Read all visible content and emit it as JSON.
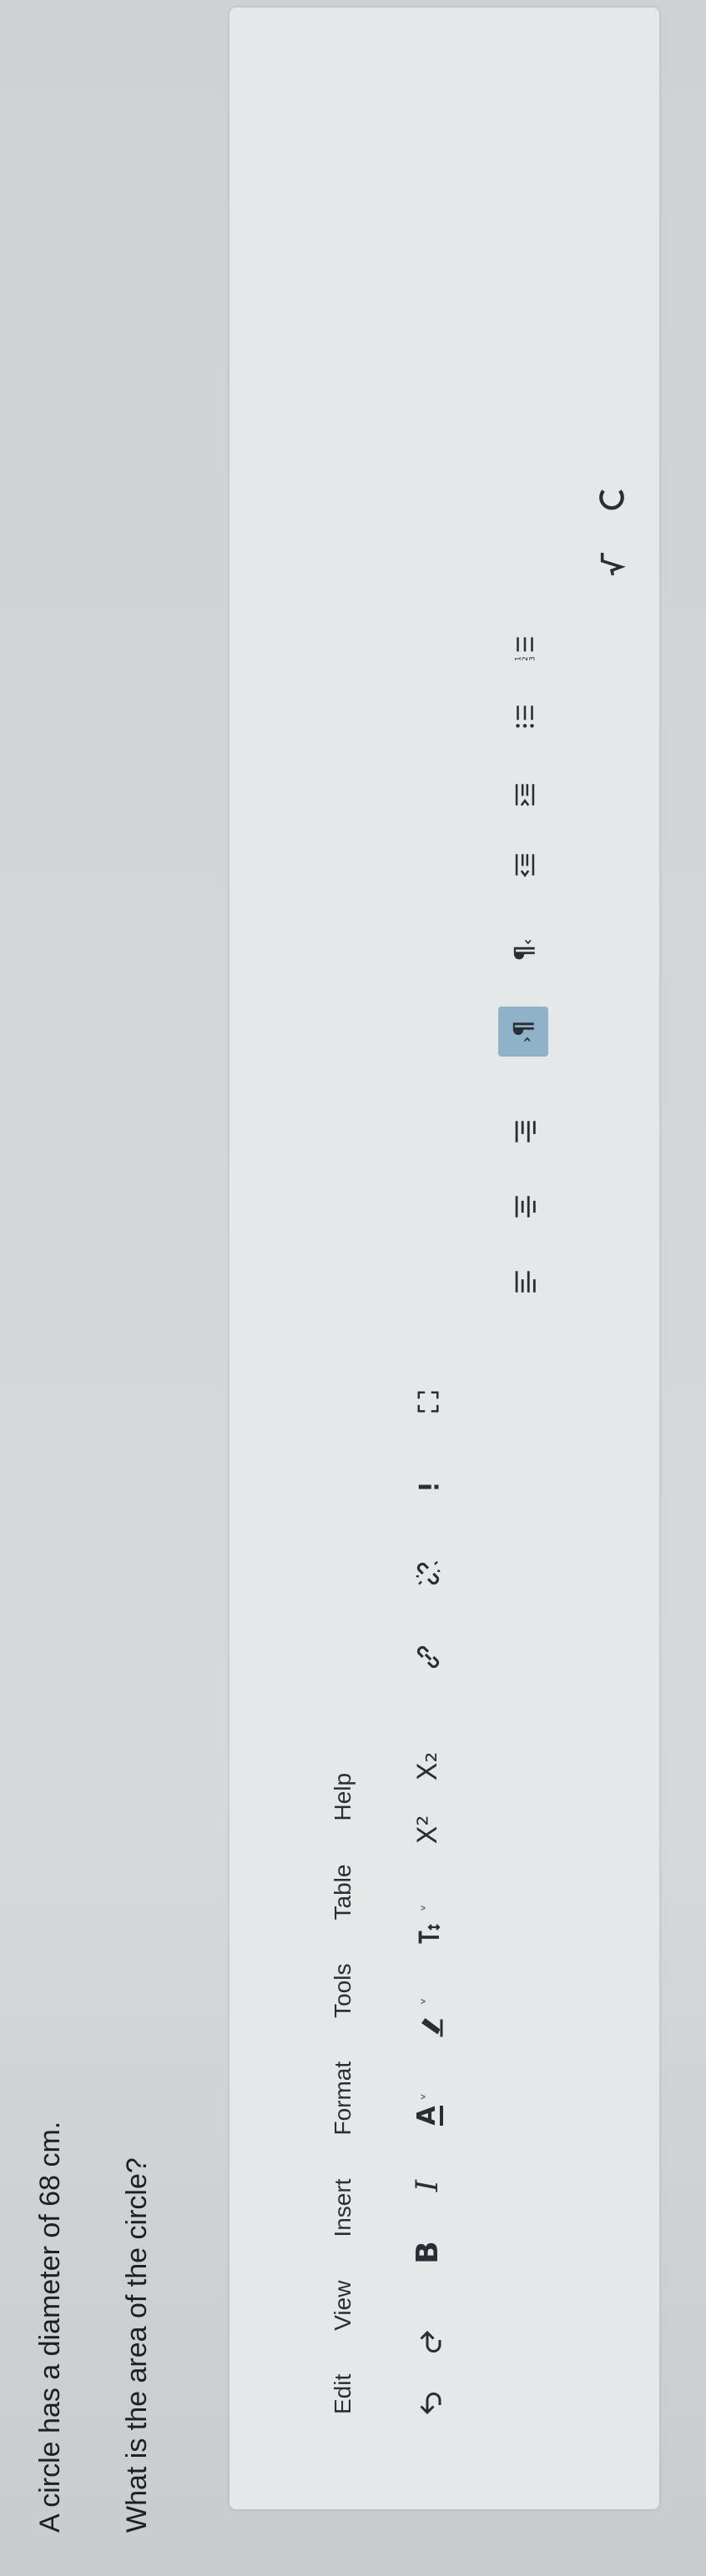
{
  "question": {
    "line1": "A circle has a diameter of 68 cm.",
    "line2": "What is the area of the circle?"
  },
  "menu": [
    "Edit",
    "View",
    "Insert",
    "Format",
    "Tools",
    "Table",
    "Help"
  ],
  "toolbar": {
    "undo": "undo-icon",
    "redo": "redo-icon",
    "bold_label": "B",
    "italic_label": "I",
    "text_color_label": "A",
    "chevron": "˅",
    "superscript_label": "X²",
    "subscript_label": "X₂",
    "rtl_label": "¶",
    "ltr_label": "¶"
  },
  "colors": {
    "background": "#9ea3a4",
    "editor": "#e5e8e9",
    "active_button": "#8fb2c8",
    "text": "#2a2d33"
  }
}
